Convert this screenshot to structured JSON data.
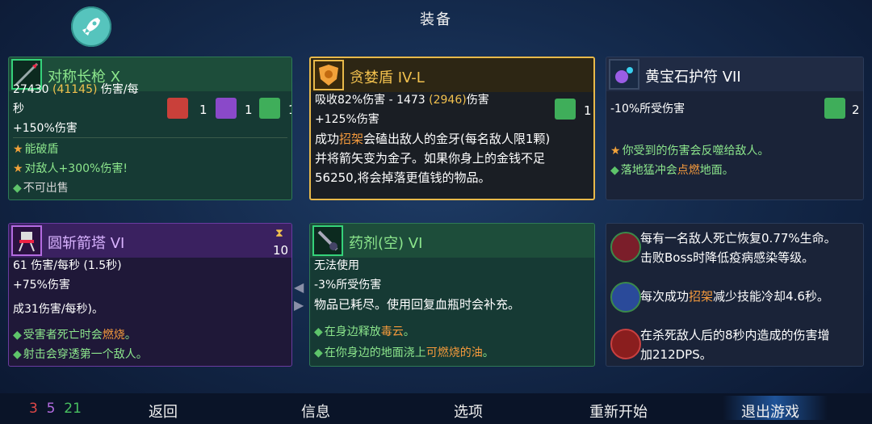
{
  "title": "装备",
  "nav": {
    "stats": {
      "red": "3",
      "purple": "5",
      "green": "21"
    },
    "back": "返回",
    "info": "信息",
    "options": "选项",
    "restart": "重新开始",
    "quit": "退出游戏"
  },
  "weapon1": {
    "name": "对称长枪",
    "tier": "X",
    "dps": "27430",
    "dps_crit": "(41145)",
    "dps_unit": "伤害/每",
    "dps_unit2": "秒",
    "scroll_red": "1",
    "scroll_purple": "1",
    "scroll_green": "1",
    "stat1": "+150%伤害",
    "affix1": "能破盾",
    "affix2": "对敌人+300%伤害!",
    "affix3": "不可出售"
  },
  "shield": {
    "name": "贪婪盾",
    "tier": "IV-L",
    "stat1_pre": "吸收82%伤害 - 1473",
    "stat1_crit": "(2946)",
    "stat1_post": "伤害",
    "scroll_green": "1",
    "stat2": "+125%伤害",
    "desc1_a": "成功",
    "desc1_b": "招架",
    "desc1_c": "会磕出敌人的金牙(每名敌人限1颗)",
    "desc2": "并将箭矢变为金子。如果你身上的金钱不足",
    "desc3": "56250,将会掉落更值钱的物品。"
  },
  "amulet": {
    "name": "黄宝石护符",
    "tier": "VII",
    "stat1": "-10%所受伤害",
    "scroll_green": "2",
    "affix1": "你受到的伤害会反噬给敌人。",
    "affix2_a": "落地猛冲会",
    "affix2_b": "点燃",
    "affix2_c": "地面。"
  },
  "turret": {
    "name": "圆斩箭塔",
    "tier": "VI",
    "cooldown": "10",
    "stat1": "61 伤害/每秒 (1.5秒)",
    "stat2": "+75%伤害",
    "stat3": "成31伤害/每秒)。",
    "affix1_a": "受害者死亡时会",
    "affix1_b": "燃烧",
    "affix1_c": "。",
    "affix2": "射击会穿透第一个敌人。"
  },
  "potion": {
    "name": "药剂(空)",
    "tier": "VI",
    "stat1": "无法使用",
    "stat2": "-3%所受伤害",
    "stat3": "物品已耗尽。使用回复血瓶时会补充。",
    "affix1_a": "在身边释放",
    "affix1_b": "毒云",
    "affix1_c": "。",
    "affix2_a": "在你身边的地面浇上",
    "affix2_b": "可燃烧的油",
    "affix2_c": "。"
  },
  "mutations": [
    {
      "text1": "每有一名敌人死亡恢复0.77%生命。",
      "text2": "击败Boss时降低疫病感染等级。"
    },
    {
      "text1_a": "每次成功",
      "text1_b": "招架",
      "text1_c": "减少技能冷却4.6秒。"
    },
    {
      "text1": "在杀死敌人后的8秒内造成的伤害增",
      "text2": "加212DPS。"
    }
  ],
  "colors": {
    "green": "#35d27a",
    "orange": "#e8b94a",
    "purple": "#b36be0",
    "highlight_orange": "#f59a3c"
  }
}
